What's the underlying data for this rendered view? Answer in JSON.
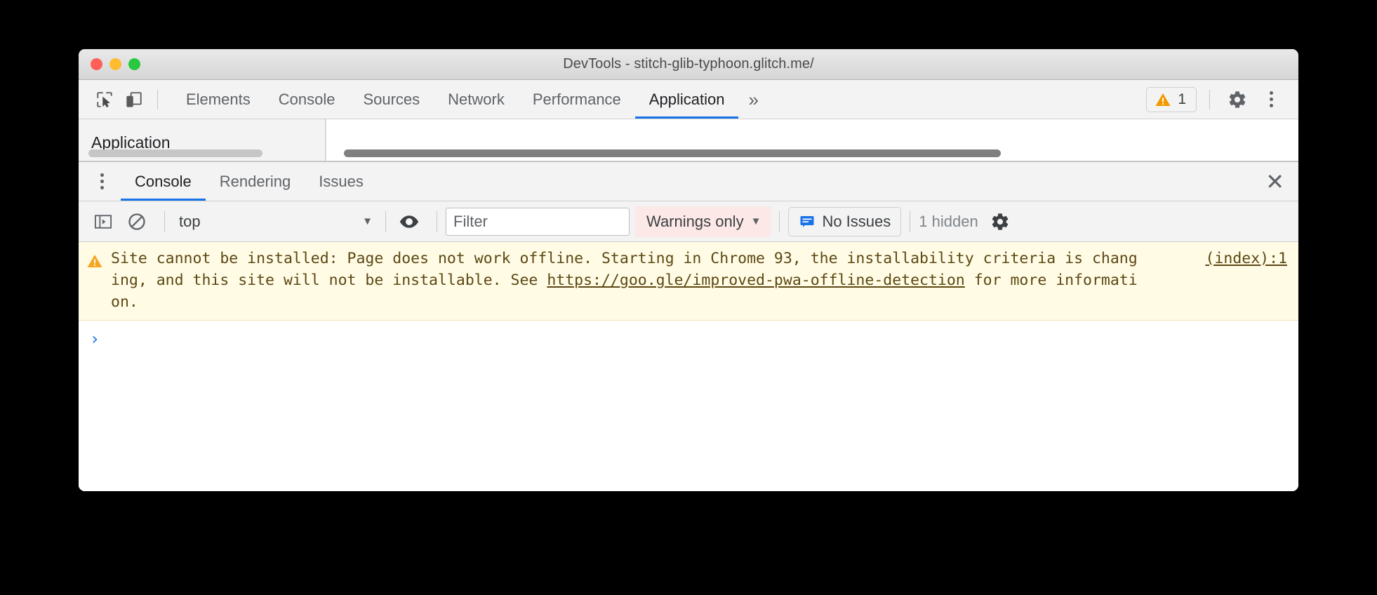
{
  "window": {
    "title": "DevTools - stitch-glib-typhoon.glitch.me/",
    "traffic_lights": [
      "close",
      "minimize",
      "zoom"
    ]
  },
  "toolbar": {
    "inspect_icon": "inspect-cursor-icon",
    "device_icon": "device-toolbar-icon",
    "tabs": [
      {
        "label": "Elements",
        "active": false
      },
      {
        "label": "Console",
        "active": false
      },
      {
        "label": "Sources",
        "active": false
      },
      {
        "label": "Network",
        "active": false
      },
      {
        "label": "Performance",
        "active": false
      },
      {
        "label": "Application",
        "active": true
      }
    ],
    "more_tabs_label": "»",
    "warning_count": "1",
    "settings_icon": "gear-icon",
    "menu_icon": "kebab-menu-icon",
    "accent_color": "#1a73e8",
    "warning_color": "#f29900"
  },
  "application_panel": {
    "sidebar_title": "Application",
    "content_title": "",
    "sidebar_scrollbar": "horizontal-scrollbar",
    "content_scrollbar": "horizontal-scrollbar"
  },
  "drawer": {
    "menu_icon": "kebab-menu-icon",
    "tabs": [
      {
        "label": "Console",
        "active": true
      },
      {
        "label": "Rendering",
        "active": false
      },
      {
        "label": "Issues",
        "active": false
      }
    ],
    "close_label": "✕"
  },
  "console_toolbar": {
    "sidebar_toggle_icon": "console-sidebar-icon",
    "clear_icon": "clear-console-icon",
    "context_value": "top",
    "context_caret": "▼",
    "eye_icon": "live-expression-icon",
    "filter_placeholder": "Filter",
    "filter_value": "",
    "level_value": "Warnings only",
    "level_caret": "▼",
    "level_active_color": "#fce8e6",
    "issues_label": "No Issues",
    "issues_icon": "issues-message-icon",
    "issues_icon_color": "#1a73e8",
    "hidden_label": "1 hidden",
    "settings_icon": "gear-icon"
  },
  "console": {
    "messages": [
      {
        "level": "warning",
        "icon": "warning-triangle-icon",
        "text_before_link": "Site cannot be installed: Page does not work offline. Starting in Chrome 93, the installability criteria is changing, and this site will not be installable. See ",
        "link_text": "https://goo.gle/improved-pwa-offline-detection",
        "text_after_link": " for more information.",
        "source": "(index):1",
        "background_color": "#fffbe5",
        "text_color": "#5c4813"
      }
    ],
    "prompt_symbol": "›"
  }
}
